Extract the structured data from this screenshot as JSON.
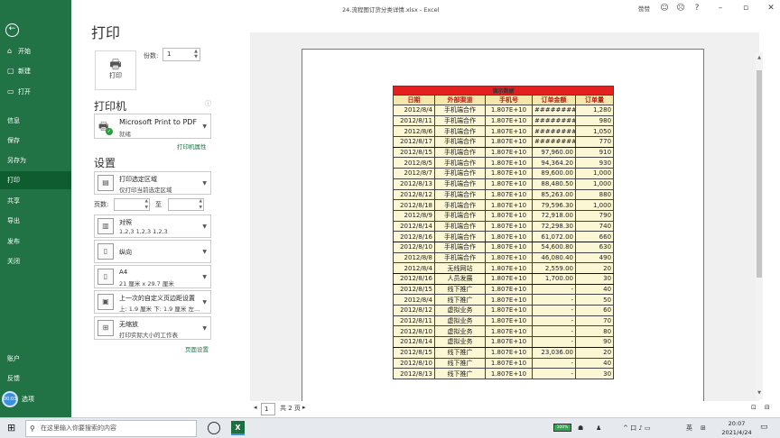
{
  "window": {
    "title": "24.流程图订货分类详情.xlsx - Excel",
    "account": "赞赞"
  },
  "sidebar": {
    "items": [
      {
        "label": "开始",
        "icon": "⌂"
      },
      {
        "label": "新建",
        "icon": "▢"
      },
      {
        "label": "打开",
        "icon": "▭"
      },
      {
        "label": "信息",
        "icon": ""
      },
      {
        "label": "保存",
        "icon": ""
      },
      {
        "label": "另存为",
        "icon": ""
      },
      {
        "label": "打印",
        "icon": ""
      },
      {
        "label": "共享",
        "icon": ""
      },
      {
        "label": "导出",
        "icon": ""
      },
      {
        "label": "发布",
        "icon": ""
      },
      {
        "label": "关闭",
        "icon": ""
      }
    ],
    "bottom": [
      {
        "label": "账户"
      },
      {
        "label": "反馈"
      },
      {
        "label": "选项"
      }
    ],
    "timer": "00:03"
  },
  "print_panel": {
    "title": "打印",
    "print_button": "打印",
    "copies_label": "份数:",
    "copies_value": "1",
    "printer_heading": "打印机",
    "printer_name": "Microsoft Print to PDF",
    "printer_status": "就绪",
    "printer_props": "打印机属性",
    "settings_heading": "设置",
    "settings": [
      {
        "line1": "打印选定区域",
        "line2": "仅打印当前选定区域"
      },
      {
        "line1": "对照",
        "line2": "1,2,3    1,2,3    1,2,3"
      },
      {
        "line1": "纵向",
        "line2": ""
      },
      {
        "line1": "A4",
        "line2": "21 厘米 x 29.7 厘米"
      },
      {
        "line1": "上一次的自定义页边距设置",
        "line2": "上: 1.9 厘米 下: 1.9 厘米 左..."
      },
      {
        "line1": "无缩放",
        "line2": "打印实际大小的工作表"
      }
    ],
    "pages_label": "页数:",
    "to_label": "至",
    "page_setup": "页面设置"
  },
  "sheet": {
    "title_row": "演示数据",
    "headers": [
      "日期",
      "外部渠道",
      "手机号",
      "订单金额",
      "订单量"
    ],
    "rows": [
      [
        "2012/8/4",
        "手机端合作",
        "1.807E+10",
        "########",
        "1,280"
      ],
      [
        "2012/8/11",
        "手机端合作",
        "1.807E+10",
        "########",
        "980"
      ],
      [
        "2012/8/6",
        "手机端合作",
        "1.807E+10",
        "########",
        "1,050"
      ],
      [
        "2012/8/17",
        "手机端合作",
        "1.807E+10",
        "########",
        "770"
      ],
      [
        "2012/8/15",
        "手机端合作",
        "1.807E+10",
        "97,960.00",
        "910"
      ],
      [
        "2012/8/5",
        "手机端合作",
        "1.807E+10",
        "94,364.20",
        "930"
      ],
      [
        "2012/8/7",
        "手机端合作",
        "1.807E+10",
        "89,600.00",
        "1,000"
      ],
      [
        "2012/8/13",
        "手机端合作",
        "1.807E+10",
        "88,480.50",
        "1,000"
      ],
      [
        "2012/8/12",
        "手机端合作",
        "1.807E+10",
        "85,263.00",
        "880"
      ],
      [
        "2012/8/18",
        "手机端合作",
        "1.807E+10",
        "79,596.30",
        "1,000"
      ],
      [
        "2012/8/9",
        "手机端合作",
        "1.807E+10",
        "72,918.00",
        "790"
      ],
      [
        "2012/8/14",
        "手机端合作",
        "1.807E+10",
        "72,298.30",
        "740"
      ],
      [
        "2012/8/16",
        "手机端合作",
        "1.807E+10",
        "61,072.00",
        "660"
      ],
      [
        "2012/8/10",
        "手机端合作",
        "1.807E+10",
        "54,600.80",
        "630"
      ],
      [
        "2012/8/8",
        "手机端合作",
        "1.807E+10",
        "46,080.40",
        "490"
      ],
      [
        "2012/8/4",
        "无线网站",
        "1.807E+10",
        "2,559.00",
        "20"
      ],
      [
        "2012/8/16",
        "人员发展",
        "1.807E+10",
        "1,700.00",
        "30"
      ],
      [
        "2012/8/15",
        "线下推广",
        "1.807E+10",
        "-",
        "40"
      ],
      [
        "2012/8/4",
        "线下推广",
        "1.807E+10",
        "-",
        "50"
      ],
      [
        "2012/8/12",
        "虚拟业务",
        "1.807E+10",
        "-",
        "60"
      ],
      [
        "2012/8/11",
        "虚拟业务",
        "1.807E+10",
        "-",
        "70"
      ],
      [
        "2012/8/10",
        "虚拟业务",
        "1.807E+10",
        "-",
        "80"
      ],
      [
        "2012/8/14",
        "虚拟业务",
        "1.807E+10",
        "-",
        "90"
      ],
      [
        "2012/8/15",
        "线下推广",
        "1.807E+10",
        "23,036.00",
        "20"
      ],
      [
        "2012/8/10",
        "线下推广",
        "1.807E+10",
        "-",
        "40"
      ],
      [
        "2012/8/13",
        "线下推广",
        "1.807E+10",
        "-",
        "30"
      ]
    ]
  },
  "page_nav": {
    "current": "1",
    "total": "共 2 页"
  },
  "taskbar": {
    "search_placeholder": "在这里输入你要搜索的内容",
    "battery": "100%",
    "time": "20:07",
    "date": "2021/4/24",
    "ime": "英",
    "tray": "^ 口 ♪ ▭"
  }
}
